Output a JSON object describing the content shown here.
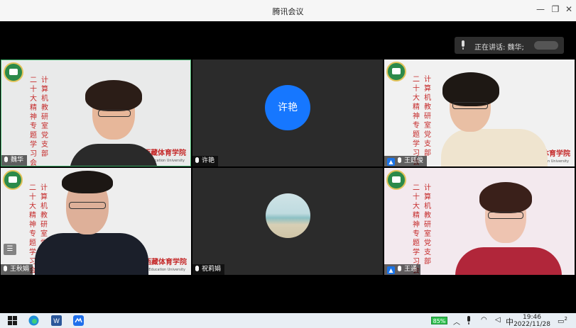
{
  "window": {
    "title": "腾讯会议",
    "minimize": "—",
    "restore": "❐",
    "close": "✕"
  },
  "speaking": {
    "label": "正在讲话: 魏华;"
  },
  "tiles": [
    {
      "name": "魏华"
    },
    {
      "name": "许艳",
      "avatar_text": "许艳"
    },
    {
      "name": "王廷俊"
    },
    {
      "name": "王秋娟"
    },
    {
      "name": "祝莉娟"
    },
    {
      "name": "王通"
    }
  ],
  "banner": {
    "col_left": "二十大精神专题学习会",
    "col_right": "计算机教研室党支部",
    "school": "西藏体育学院",
    "school_en": "Tibet Physical Education University"
  },
  "taskbar": {
    "battery": "85%",
    "ime": "中",
    "time": "19:46",
    "date": "2022/11/28",
    "notify_count": "2"
  },
  "colors": {
    "avatar_blue": "#1677ff",
    "speaking_border": "#3fb06a"
  }
}
